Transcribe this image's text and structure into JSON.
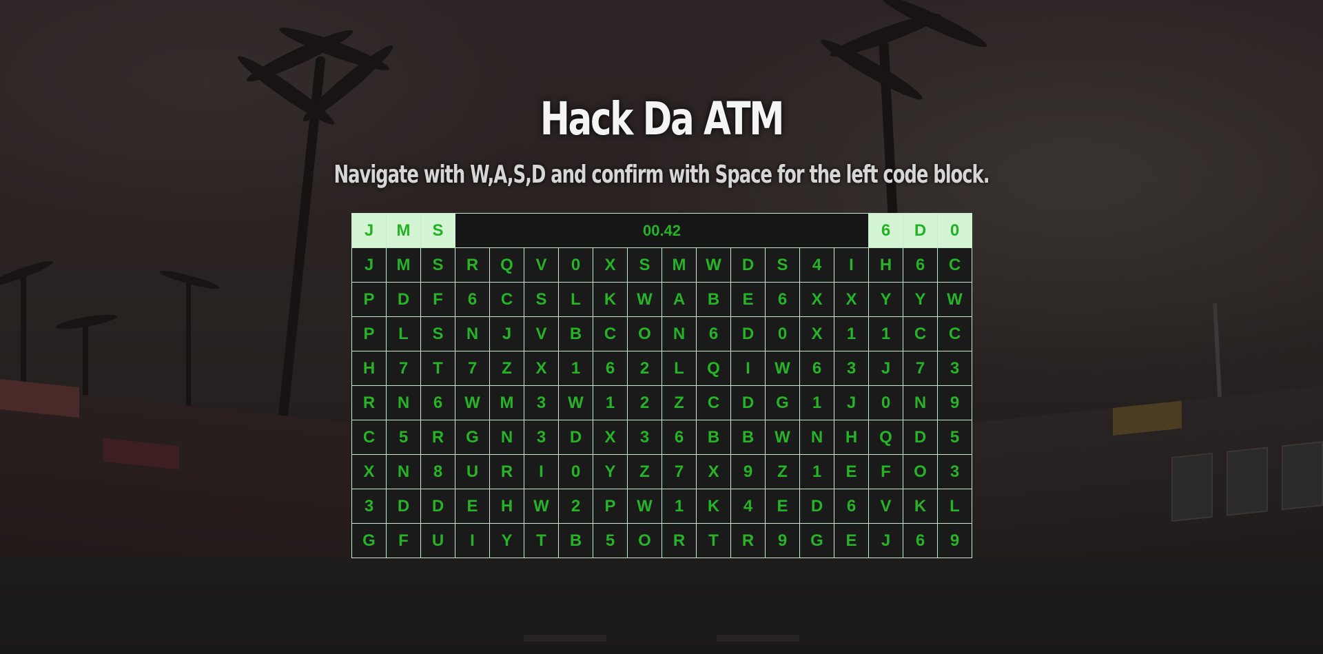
{
  "title": "Hack Da ATM",
  "subtitle": "Navigate with W,A,S,D and confirm with Space for the left code block.",
  "timer": "00.42",
  "left_code": [
    "J",
    "M",
    "S"
  ],
  "right_code": [
    "6",
    "D",
    "0"
  ],
  "grid": [
    [
      "J",
      "M",
      "S",
      "R",
      "Q",
      "V",
      "0",
      "X",
      "S",
      "M",
      "W",
      "D",
      "S",
      "4",
      "I",
      "H",
      "6",
      "C"
    ],
    [
      "P",
      "D",
      "F",
      "6",
      "C",
      "S",
      "L",
      "K",
      "W",
      "A",
      "B",
      "E",
      "6",
      "X",
      "X",
      "Y",
      "Y",
      "W"
    ],
    [
      "P",
      "L",
      "S",
      "N",
      "J",
      "V",
      "B",
      "C",
      "O",
      "N",
      "6",
      "D",
      "0",
      "X",
      "1",
      "1",
      "C",
      "C"
    ],
    [
      "H",
      "7",
      "T",
      "7",
      "Z",
      "X",
      "1",
      "6",
      "2",
      "L",
      "Q",
      "I",
      "W",
      "6",
      "3",
      "J",
      "7",
      "3"
    ],
    [
      "R",
      "N",
      "6",
      "W",
      "M",
      "3",
      "W",
      "1",
      "2",
      "Z",
      "C",
      "D",
      "G",
      "1",
      "J",
      "0",
      "N",
      "9"
    ],
    [
      "C",
      "5",
      "R",
      "G",
      "N",
      "3",
      "D",
      "X",
      "3",
      "6",
      "B",
      "B",
      "W",
      "N",
      "H",
      "Q",
      "D",
      "5"
    ],
    [
      "X",
      "N",
      "8",
      "U",
      "R",
      "I",
      "0",
      "Y",
      "Z",
      "7",
      "X",
      "9",
      "Z",
      "1",
      "E",
      "F",
      "O",
      "3"
    ],
    [
      "3",
      "D",
      "D",
      "E",
      "H",
      "W",
      "2",
      "P",
      "W",
      "1",
      "K",
      "4",
      "E",
      "D",
      "6",
      "V",
      "K",
      "L"
    ],
    [
      "G",
      "F",
      "U",
      "I",
      "Y",
      "T",
      "B",
      "5",
      "O",
      "R",
      "T",
      "R",
      "9",
      "G",
      "E",
      "J",
      "6",
      "9"
    ]
  ],
  "colors": {
    "glyph_green": "#27b327",
    "code_cell_bg": "#d4f5d4",
    "grid_cell_bg": "#1a1a1a",
    "grid_line": "#c8eccb"
  }
}
